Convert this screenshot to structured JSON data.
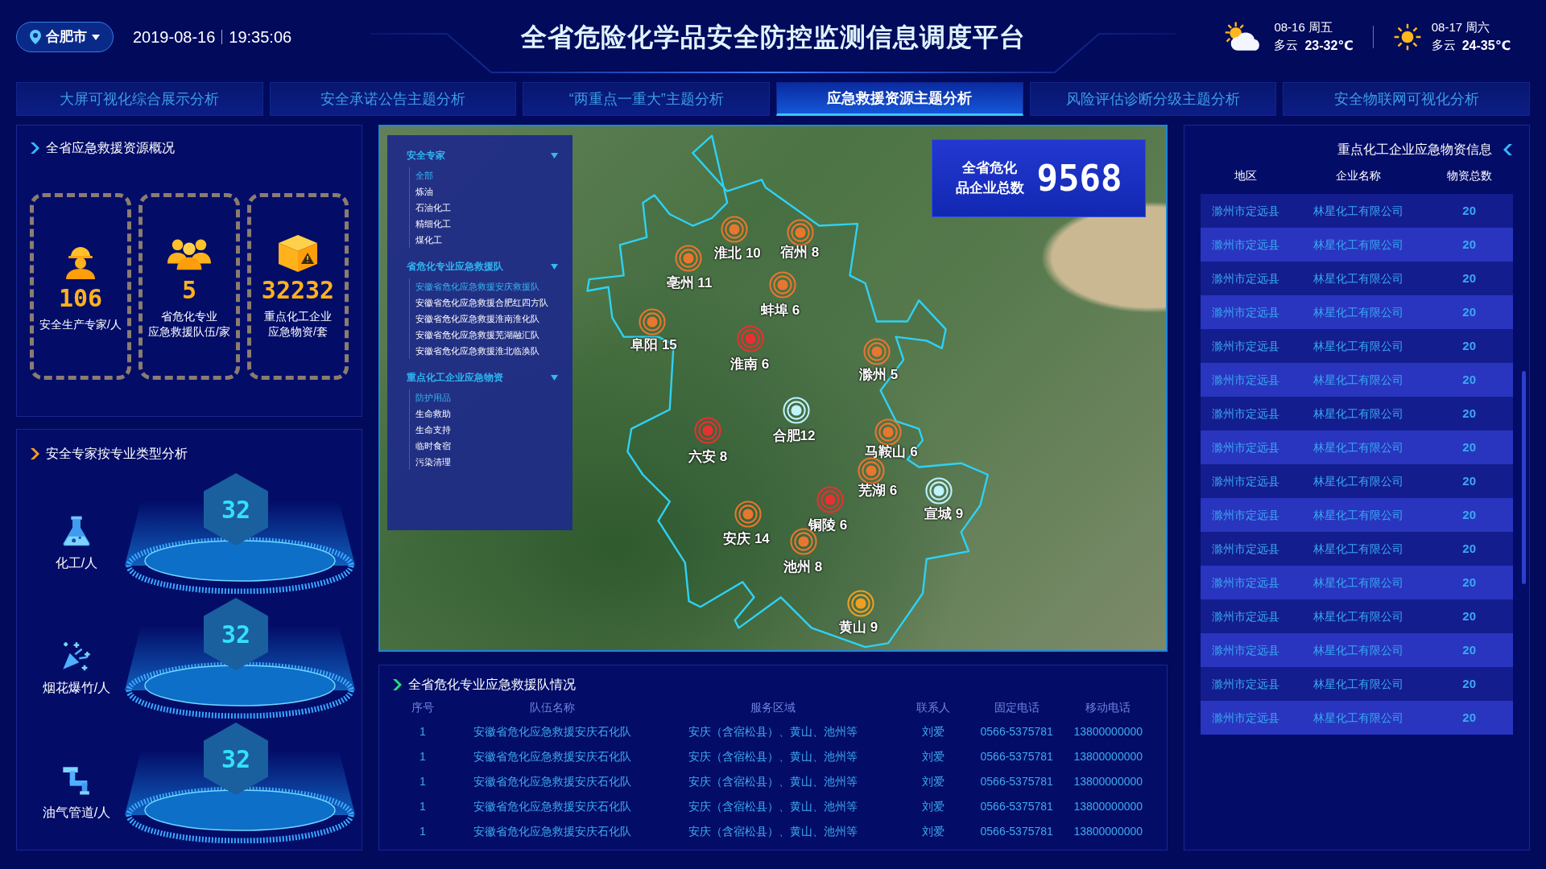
{
  "header": {
    "location": "合肥市",
    "date": "2019-08-16",
    "time": "19:35:06",
    "title": "全省危险化学品安全防控监测信息调度平台",
    "weather": [
      {
        "kind": "partly-cloudy",
        "date": "08-16 周五",
        "condition": "多云",
        "temp": "23-32℃"
      },
      {
        "kind": "sunny",
        "date": "08-17 周六",
        "condition": "多云",
        "temp": "24-35℃"
      }
    ]
  },
  "tabs": [
    {
      "label": "大屏可视化综合展示分析",
      "selected": false
    },
    {
      "label": "安全承诺公告主题分析",
      "selected": false
    },
    {
      "label": "“两重点一重大”主题分析",
      "selected": false
    },
    {
      "label": "应急救援资源主题分析",
      "selected": true
    },
    {
      "label": "风险评估诊断分级主题分析",
      "selected": false
    },
    {
      "label": "安全物联网可视化分析",
      "selected": false
    }
  ],
  "overview": {
    "title": "全省应急救援资源概况",
    "cards": [
      {
        "kind": "expert",
        "value": "106",
        "label": [
          "安全生产专家/人"
        ]
      },
      {
        "kind": "team",
        "value": "5",
        "label": [
          "省危化专业",
          "应急救援队伍/家"
        ]
      },
      {
        "kind": "supplies",
        "value": "32232",
        "label": [
          "重点化工企业",
          "应急物资/套"
        ]
      }
    ]
  },
  "expert_types": {
    "title": "安全专家按专业类型分析",
    "items": [
      {
        "kind": "chemical",
        "label": "化工/人",
        "value": "32"
      },
      {
        "kind": "fireworks",
        "label": "烟花爆竹/人",
        "value": "32"
      },
      {
        "kind": "pipeline",
        "label": "油气管道/人",
        "value": "32"
      }
    ]
  },
  "map": {
    "menu": [
      {
        "title": "安全专家",
        "expanded": true,
        "items": [
          {
            "label": "全部",
            "selected": true
          },
          {
            "label": "炼油",
            "selected": false
          },
          {
            "label": "石油化工",
            "selected": false
          },
          {
            "label": "精细化工",
            "selected": false
          },
          {
            "label": "煤化工",
            "selected": false
          }
        ]
      },
      {
        "title": "省危化专业应急救援队",
        "expanded": true,
        "items": [
          {
            "label": "安徽省危化应急救援安庆救援队",
            "selected": true
          },
          {
            "label": "安徽省危化应急救援合肥红四方队",
            "selected": false
          },
          {
            "label": "安徽省危化应急救援淮南淮化队",
            "selected": false
          },
          {
            "label": "安徽省危化应急救援芜湖融汇队",
            "selected": false
          },
          {
            "label": "安徽省危化应急救援淮北临涣队",
            "selected": false
          }
        ]
      },
      {
        "title": "重点化工企业应急物资",
        "expanded": true,
        "items": [
          {
            "label": "防护用品",
            "selected": true
          },
          {
            "label": "生命救助",
            "selected": false
          },
          {
            "label": "生命支持",
            "selected": false
          },
          {
            "label": "临时食宿",
            "selected": false
          },
          {
            "label": "污染清理",
            "selected": false
          }
        ]
      }
    ],
    "total": {
      "label": [
        "全省危化",
        "品企业总数"
      ],
      "value": "9568"
    },
    "cities": [
      {
        "label": "淮北 10",
        "color": "#e8772e"
      },
      {
        "label": "宿州 8",
        "color": "#e8772e"
      },
      {
        "label": "亳州 11",
        "color": "#e8772e"
      },
      {
        "label": "蚌埠 6",
        "color": "#e8772e"
      },
      {
        "label": "阜阳 15",
        "color": "#e8772e"
      },
      {
        "label": "淮南 6",
        "color": "#e83030"
      },
      {
        "label": "滁州 5",
        "color": "#e8772e"
      },
      {
        "label": "合肥12",
        "color": "#bff4ff"
      },
      {
        "label": "六安 8",
        "color": "#e83030"
      },
      {
        "label": "马鞍山 6",
        "color": "#e8772e"
      },
      {
        "label": "芜湖 6",
        "color": "#e8772e"
      },
      {
        "label": "宣城 9",
        "color": "#bff4ff"
      },
      {
        "label": "铜陵 6",
        "color": "#e83030"
      },
      {
        "label": "安庆 14",
        "color": "#e8772e"
      },
      {
        "label": "池州 8",
        "color": "#e8772e"
      },
      {
        "label": "黄山 9",
        "color": "#f0a020"
      }
    ]
  },
  "teams_table": {
    "title": "全省危化专业应急救援队情况",
    "columns": [
      "序号",
      "队伍名称",
      "服务区域",
      "联系人",
      "固定电话",
      "移动电话"
    ],
    "rows": [
      [
        "1",
        "安徽省危化应急救援安庆石化队",
        "安庆（含宿松县）、黄山、池州等",
        "刘爱",
        "0566-5375781",
        "13800000000"
      ],
      [
        "1",
        "安徽省危化应急救援安庆石化队",
        "安庆（含宿松县）、黄山、池州等",
        "刘爱",
        "0566-5375781",
        "13800000000"
      ],
      [
        "1",
        "安徽省危化应急救援安庆石化队",
        "安庆（含宿松县）、黄山、池州等",
        "刘爱",
        "0566-5375781",
        "13800000000"
      ],
      [
        "1",
        "安徽省危化应急救援安庆石化队",
        "安庆（含宿松县）、黄山、池州等",
        "刘爱",
        "0566-5375781",
        "13800000000"
      ],
      [
        "1",
        "安徽省危化应急救援安庆石化队",
        "安庆（含宿松县）、黄山、池州等",
        "刘爱",
        "0566-5375781",
        "13800000000"
      ]
    ]
  },
  "supplies_table": {
    "title": "重点化工企业应急物资信息",
    "columns": [
      "地区",
      "企业名称",
      "物资总数"
    ],
    "rows": [
      [
        "滁州市定远县",
        "林星化工有限公司",
        "20"
      ],
      [
        "滁州市定远县",
        "林星化工有限公司",
        "20"
      ],
      [
        "滁州市定远县",
        "林星化工有限公司",
        "20"
      ],
      [
        "滁州市定远县",
        "林星化工有限公司",
        "20"
      ],
      [
        "滁州市定远县",
        "林星化工有限公司",
        "20"
      ],
      [
        "滁州市定远县",
        "林星化工有限公司",
        "20"
      ],
      [
        "滁州市定远县",
        "林星化工有限公司",
        "20"
      ],
      [
        "滁州市定远县",
        "林星化工有限公司",
        "20"
      ],
      [
        "滁州市定远县",
        "林星化工有限公司",
        "20"
      ],
      [
        "滁州市定远县",
        "林星化工有限公司",
        "20"
      ],
      [
        "滁州市定远县",
        "林星化工有限公司",
        "20"
      ],
      [
        "滁州市定远县",
        "林星化工有限公司",
        "20"
      ],
      [
        "滁州市定远县",
        "林星化工有限公司",
        "20"
      ],
      [
        "滁州市定远县",
        "林星化工有限公司",
        "20"
      ],
      [
        "滁州市定远县",
        "林星化工有限公司",
        "20"
      ],
      [
        "滁州市定远县",
        "林星化工有限公司",
        "20"
      ]
    ]
  }
}
